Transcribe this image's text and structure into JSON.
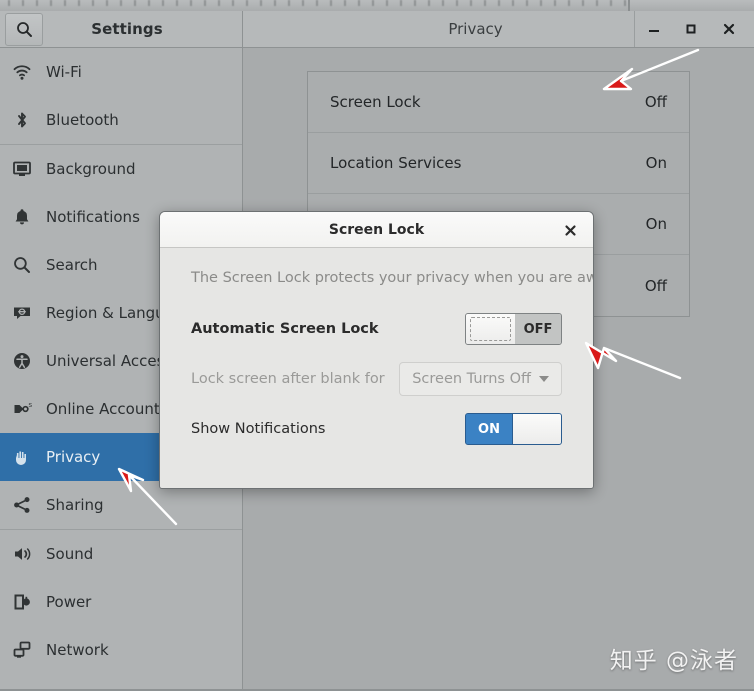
{
  "window": {
    "sidebar_title": "Settings",
    "content_title": "Privacy",
    "search_icon": "search-icon",
    "controls": {
      "minimize": "–",
      "maximize": "□",
      "close": "✕"
    }
  },
  "sidebar": {
    "items": [
      {
        "label": "Wi-Fi",
        "icon": "wifi-icon",
        "selected": false
      },
      {
        "label": "Bluetooth",
        "icon": "bluetooth-icon",
        "selected": false
      },
      {
        "label": "Background",
        "icon": "background-icon",
        "selected": false
      },
      {
        "label": "Notifications",
        "icon": "bell-icon",
        "selected": false
      },
      {
        "label": "Search",
        "icon": "search-icon",
        "selected": false
      },
      {
        "label": "Region & Language",
        "icon": "region-language-icon",
        "selected": false
      },
      {
        "label": "Universal Access",
        "icon": "universal-access-icon",
        "selected": false
      },
      {
        "label": "Online Accounts",
        "icon": "online-accounts-icon",
        "selected": false
      },
      {
        "label": "Privacy",
        "icon": "privacy-hand-icon",
        "selected": true
      },
      {
        "label": "Sharing",
        "icon": "sharing-icon",
        "selected": false
      },
      {
        "label": "Sound",
        "icon": "sound-icon",
        "selected": false
      },
      {
        "label": "Power",
        "icon": "power-icon",
        "selected": false
      },
      {
        "label": "Network",
        "icon": "network-icon",
        "selected": false
      }
    ]
  },
  "main": {
    "privacy_rows": [
      {
        "label": "Screen Lock",
        "value": "Off"
      },
      {
        "label": "Location Services",
        "value": "On"
      },
      {
        "label": "",
        "value": "On"
      },
      {
        "label": "",
        "value": "Off"
      }
    ]
  },
  "dialog": {
    "title": "Screen Lock",
    "close_label": "✕",
    "description": "The Screen Lock protects your privacy when you are away.",
    "rows": [
      {
        "label": "Automatic Screen Lock",
        "control": "toggle",
        "state": "OFF",
        "state_label": "OFF",
        "dim": false,
        "bold": true
      },
      {
        "label": "Lock screen after blank for",
        "control": "dropdown",
        "value": "Screen Turns Off",
        "dim": true,
        "bold": false
      },
      {
        "label": "Show Notifications",
        "control": "toggle",
        "state": "ON",
        "state_label": "ON",
        "dim": false,
        "bold": false
      }
    ]
  },
  "annotations": {
    "arrow_color": "#d91a19",
    "arrow_outline": "#ffffff",
    "arrows": [
      {
        "name": "arrow-to-screen-lock-row"
      },
      {
        "name": "arrow-to-privacy-sidebar-item"
      },
      {
        "name": "arrow-to-automatic-screen-lock-toggle"
      }
    ]
  },
  "watermark": {
    "text": "知乎 @泳者"
  },
  "colors": {
    "accent_blue": "#2f6fa8",
    "toggle_on_blue": "#3b82c4",
    "window_bg": "#a8abac",
    "sidebar_bg": "#b0b3b4",
    "dialog_bg": "#e6e6e4"
  }
}
